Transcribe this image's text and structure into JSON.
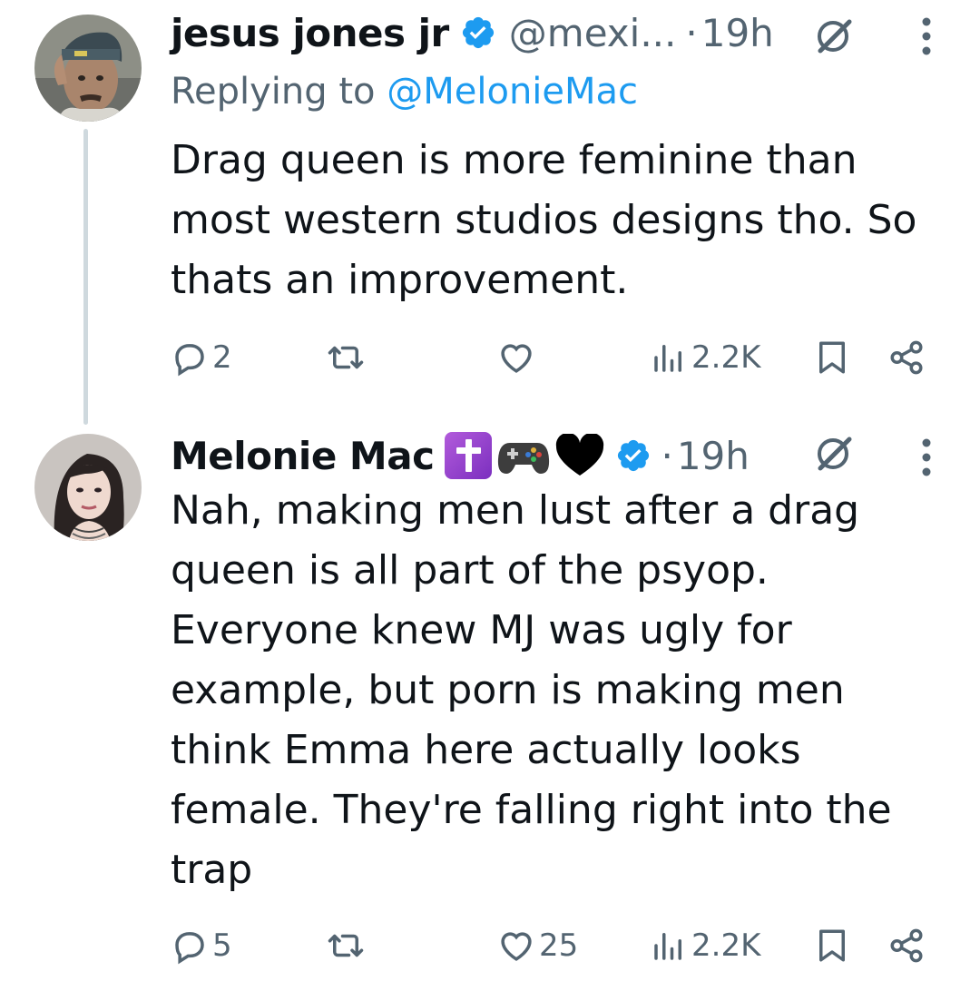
{
  "colors": {
    "text": "#0f1419",
    "secondary": "#536471",
    "link": "#1d9bf0",
    "verified": "#1d9bf0",
    "thread_line": "#cfd9de"
  },
  "tweets": [
    {
      "author_name": "jesus jones jr",
      "verified": true,
      "handle": "@mexi...",
      "separator": "·",
      "time": "19h",
      "reply_prefix": "Replying to ",
      "reply_mention": "@MelonieMac",
      "text_lines": [
        "Drag queen is more feminine than",
        "most western studios designs tho. So",
        "thats an improvement."
      ],
      "counts": {
        "replies": "2",
        "retweets": "",
        "likes": "",
        "views": "2.2K"
      },
      "icons": [
        "reply-icon",
        "retweet-icon",
        "like-icon",
        "views-icon",
        "bookmark-icon",
        "share-icon",
        "grok-icon",
        "more-icon"
      ]
    },
    {
      "author_name": "Melonie Mac",
      "name_emoji": [
        "latin-cross-emoji",
        "video-game-emoji",
        "black-heart-emoji"
      ],
      "verified": true,
      "separator": "·",
      "time": "19h",
      "text_lines": [
        "Nah, making men lust after a drag",
        "queen is all part of the psyop.",
        "Everyone knew MJ was ugly for",
        "example, but porn is making men",
        "think Emma here actually looks",
        "female. They're falling right into the",
        "trap"
      ],
      "counts": {
        "replies": "5",
        "retweets": "",
        "likes": "25",
        "views": "2.2K"
      },
      "icons": [
        "reply-icon",
        "retweet-icon",
        "like-icon",
        "views-icon",
        "bookmark-icon",
        "share-icon",
        "grok-icon",
        "more-icon"
      ]
    }
  ]
}
